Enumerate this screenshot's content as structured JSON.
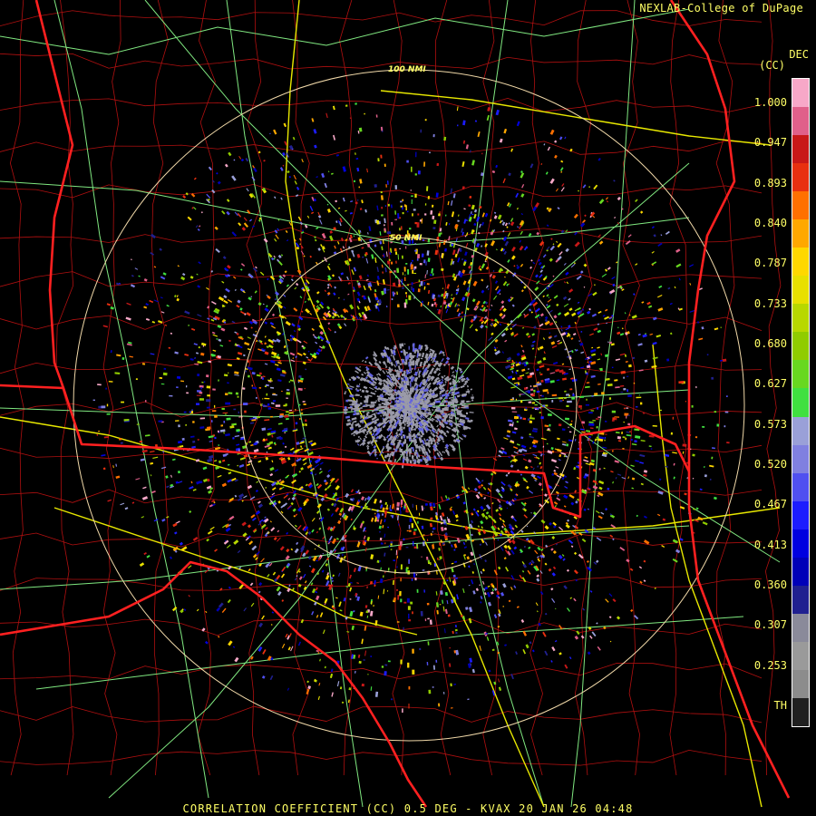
{
  "credit": "NEXLAB-College of DuPage",
  "legend": {
    "unit_top": "DEC",
    "unit_bottom": "(CC)",
    "ticks": [
      "1.000",
      "0.947",
      "0.893",
      "0.840",
      "0.787",
      "0.733",
      "0.680",
      "0.627",
      "0.573",
      "0.520",
      "0.467",
      "0.413",
      "0.360",
      "0.307",
      "0.253",
      "TH"
    ],
    "colors": [
      "#f7a8c8",
      "#e0608a",
      "#c81818",
      "#e83010",
      "#ff7000",
      "#ffa800",
      "#ffd800",
      "#e8e000",
      "#b8d800",
      "#90cc00",
      "#68d820",
      "#40e040",
      "#9aa0d8",
      "#8080e0",
      "#5050f0",
      "#1c1cff",
      "#0000e0",
      "#0000b8",
      "#202090",
      "#8a8a9a",
      "#9a9a9a",
      "#8c8c8c",
      "#202020"
    ]
  },
  "rings": {
    "inner_label": "50 NMI",
    "outer_label": "100 NMI"
  },
  "footer": "CORRELATION COEFFICIENT (CC) 0.5 DEG - KVAX 20 JAN 26 04:48",
  "colors": {
    "text": "#ffff66",
    "state_line": "#ff2020",
    "county_line": "#b01010",
    "highway_major": "#e8e800",
    "highway_minor": "#80e880",
    "range_ring": "#f0d8a8"
  }
}
